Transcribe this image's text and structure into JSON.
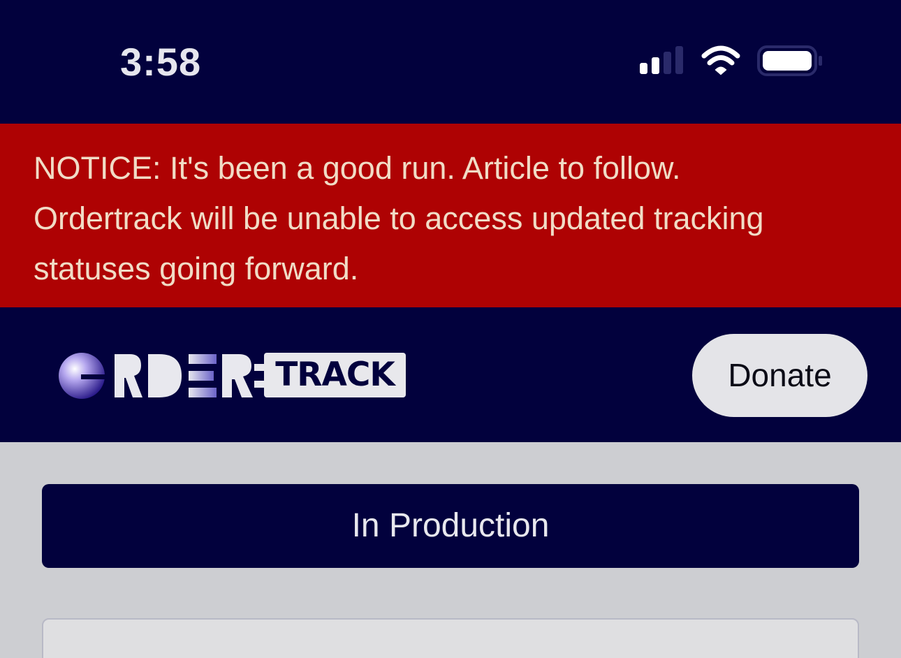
{
  "status_bar": {
    "time": "3:58",
    "icons": [
      "cellular-signal-icon",
      "wifi-icon",
      "battery-icon"
    ]
  },
  "notice": {
    "line1": "NOTICE: It's been a good run. Article to follow.",
    "line2": "Ordertrack will be unable to access updated tracking",
    "line3": "statuses going forward."
  },
  "header": {
    "logo_track_text": "TRACK",
    "donate_label": "Donate"
  },
  "order": {
    "status_label": "In Production"
  },
  "colors": {
    "navy": "#02013d",
    "notice_red": "#ae0203",
    "notice_text": "#f1dcc6",
    "page_bg": "#cdced2",
    "pill_light": "#e4e4e8"
  }
}
